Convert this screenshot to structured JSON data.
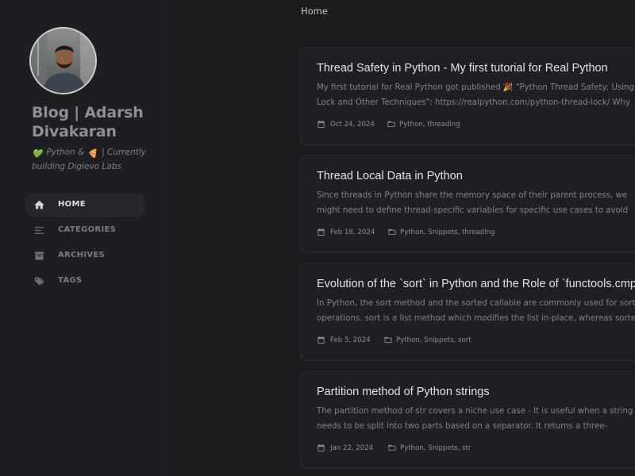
{
  "sidebar": {
    "site_title": "Blog | Adarsh Divakaran",
    "subtitle_part1": "Python &",
    "subtitle_part2": "| Currently building Digievo Labs",
    "subtitle_emoji1": "💚",
    "subtitle_emoji2": "🍕",
    "nav": [
      {
        "label": "HOME",
        "icon": "home-icon",
        "active": true
      },
      {
        "label": "CATEGORIES",
        "icon": "categories-icon",
        "active": false
      },
      {
        "label": "ARCHIVES",
        "icon": "archive-icon",
        "active": false
      },
      {
        "label": "TAGS",
        "icon": "tags-icon",
        "active": false
      }
    ]
  },
  "breadcrumb": "Home",
  "posts": [
    {
      "title": "Thread Safety in Python - My first tutorial for Real Python",
      "excerpt": "My first tutorial for Real Python got published 🎉 \"Python Thread Safety: Using a Lock and Other Techniques\": https://realpython.com/python-thread-lock/ Why thread safety? Below",
      "date": "Oct 24, 2024",
      "categories": "Python, threading"
    },
    {
      "title": "Thread Local Data in Python",
      "excerpt": "Since threads in Python share the memory space of their parent process, we might need to define thread-specific variables for specific use cases to avoid unintended side effects. In this article",
      "date": "Feb 18, 2024",
      "categories": "Python, Snippets, threading"
    },
    {
      "title": "Evolution of the `sort` in Python and the Role of `functools.cmp_to_key`",
      "excerpt": "In Python, the sort method and the sorted callable are commonly used for sorting operations. sort is a list method which modifies the list in-place, whereas sorted takes an iterable as its first",
      "date": "Feb 5, 2024",
      "categories": "Python, Snippets, sort"
    },
    {
      "title": "Partition method of Python strings",
      "excerpt": "The partition method of str covers a niche use case - It is useful when a string needs to be split into two parts based on a separator. It returns a three-membered tuple containing the part",
      "date": "Jan 22, 2024",
      "categories": "Python, Snippets, str"
    }
  ],
  "colors": {
    "background": "#1b1b1e",
    "sidebar": "#1e1e22",
    "card": "#1f1f23",
    "title_text": "#e3e3e6",
    "muted_text": "#818287"
  }
}
